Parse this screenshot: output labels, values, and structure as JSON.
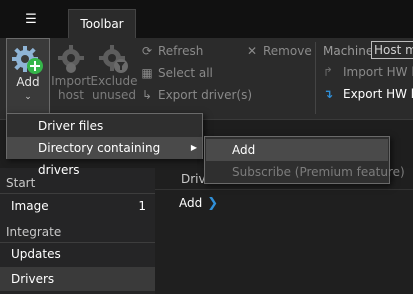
{
  "app": {
    "menu_icon": "hamburger-icon",
    "tabs": [
      {
        "label": "Toolbar",
        "active": true
      }
    ]
  },
  "ribbon": {
    "add": {
      "label": "Add",
      "icon": "gear-plus-icon",
      "accent": "#35b54a"
    },
    "import_host": {
      "label_line1": "Import",
      "label_line2": "host",
      "icon": "gear-arrow-icon",
      "enabled": false
    },
    "exclude_unused": {
      "label_line1": "Exclude",
      "label_line2": "unused",
      "icon": "gear-filter-icon",
      "enabled": false
    },
    "refresh": {
      "label": "Refresh",
      "icon": "refresh-icon",
      "enabled": false
    },
    "select_all": {
      "label": "Select all",
      "icon": "select-all-icon",
      "enabled": false
    },
    "export_drivers": {
      "label": "Export driver(s)",
      "icon": "export-icon",
      "enabled": false
    },
    "remove": {
      "label": "Remove",
      "icon": "remove-icon",
      "enabled": false
    },
    "machine": {
      "label": "Machine",
      "value": "Host ma"
    },
    "import_hw": {
      "label": "Import HW lis",
      "icon": "import-hw-icon",
      "enabled": false
    },
    "export_hw": {
      "label": "Export HW lis",
      "icon": "export-hw-icon",
      "enabled": true,
      "accent": "#2f8fd8"
    }
  },
  "dropdown": {
    "items": [
      {
        "label": "Driver files"
      },
      {
        "label": "Directory containing drivers",
        "has_submenu": true,
        "selected": true
      }
    ],
    "submenu": [
      {
        "label": "Add",
        "selected": true
      },
      {
        "label": "Subscribe (Premium feature)",
        "enabled": false
      }
    ]
  },
  "sidebar": {
    "sections": [
      {
        "title": "Start",
        "items": [
          {
            "label": "Image",
            "count": "1"
          }
        ]
      },
      {
        "title": "Integrate",
        "items": [
          {
            "label": "Updates"
          },
          {
            "label": "Drivers",
            "active": true
          }
        ]
      }
    ]
  },
  "content": {
    "header_label": "Driv",
    "breadcrumb": {
      "label": "Add",
      "icon": "chevron-right-icon"
    }
  }
}
